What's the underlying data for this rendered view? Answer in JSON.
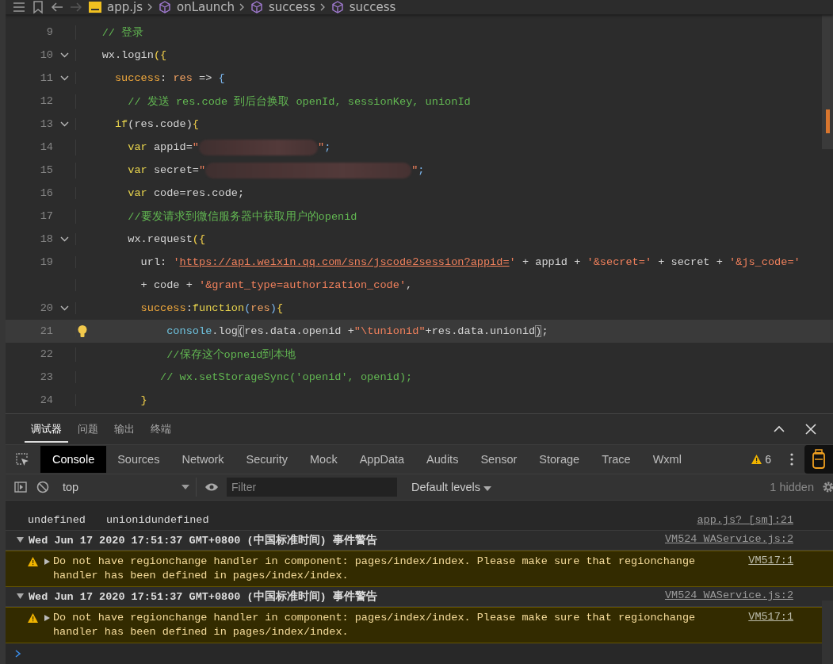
{
  "editor": {
    "breadcrumb": [
      {
        "kind": "file",
        "text": "app.js"
      },
      {
        "kind": "symbol",
        "text": "onLaunch"
      },
      {
        "kind": "symbol",
        "text": "success"
      },
      {
        "kind": "symbol",
        "text": "success"
      }
    ],
    "lines": [
      {
        "number": "9",
        "foldable": false,
        "tokens": [
          {
            "kind": "comment",
            "text": "    // 登录"
          }
        ]
      },
      {
        "number": "10",
        "foldable": true,
        "tokens": [
          {
            "kind": "plain",
            "text": "    wx.login"
          },
          {
            "kind": "brace",
            "text": "({"
          }
        ]
      },
      {
        "number": "11",
        "foldable": true,
        "tokens": [
          {
            "kind": "prop",
            "text": "      success"
          },
          {
            "kind": "plain",
            "text": ": "
          },
          {
            "kind": "param",
            "text": "res"
          },
          {
            "kind": "plain",
            "text": " => "
          },
          {
            "kind": "brace2",
            "text": "{"
          }
        ]
      },
      {
        "number": "12",
        "foldable": false,
        "tokens": [
          {
            "kind": "comment",
            "text": "        // 发送 res.code 到后台换取 openId, sessionKey, unionId"
          }
        ]
      },
      {
        "number": "13",
        "foldable": true,
        "tokens": [
          {
            "kind": "keyword",
            "text": "      if"
          },
          {
            "kind": "plain",
            "text": "(res.code)"
          },
          {
            "kind": "brace",
            "text": "{"
          }
        ]
      },
      {
        "number": "14",
        "foldable": false,
        "tokens": [
          {
            "kind": "keyword",
            "text": "        var"
          },
          {
            "kind": "plain",
            "text": " appid="
          },
          {
            "kind": "string",
            "text": "\""
          },
          {
            "kind": "redacted"
          },
          {
            "kind": "string",
            "text": "\""
          },
          {
            "kind": "punct",
            "text": ";"
          }
        ]
      },
      {
        "number": "15",
        "foldable": false,
        "tokens": [
          {
            "kind": "keyword",
            "text": "        var"
          },
          {
            "kind": "plain",
            "text": " secret="
          },
          {
            "kind": "string",
            "text": "\""
          },
          {
            "kind": "redacted_long"
          },
          {
            "kind": "string",
            "text": "\""
          },
          {
            "kind": "punct",
            "text": ";"
          }
        ]
      },
      {
        "number": "16",
        "foldable": false,
        "tokens": [
          {
            "kind": "keyword",
            "text": "        var"
          },
          {
            "kind": "plain",
            "text": " code=res.code;"
          }
        ]
      },
      {
        "number": "17",
        "foldable": false,
        "tokens": [
          {
            "kind": "comment",
            "text": "        //要发请求到微信服务器中获取用户的openid"
          }
        ]
      },
      {
        "number": "18",
        "foldable": true,
        "tokens": [
          {
            "kind": "plain",
            "text": "        wx.request"
          },
          {
            "kind": "brace",
            "text": "({"
          }
        ]
      },
      {
        "number": "19",
        "foldable": false,
        "tokens": [
          {
            "kind": "plain",
            "text": "          url: "
          },
          {
            "kind": "string",
            "text": "'"
          },
          {
            "kind": "url",
            "text": "https://api.weixin.qq.com/sns/jscode2session?appid="
          },
          {
            "kind": "string",
            "text": "'"
          },
          {
            "kind": "plain",
            "text": " + appid + "
          },
          {
            "kind": "string",
            "text": "'&secret='"
          },
          {
            "kind": "plain",
            "text": " + secret + "
          },
          {
            "kind": "string",
            "text": "'&js_code='"
          }
        ]
      },
      {
        "foldable": false,
        "tokens": [
          {
            "kind": "plain",
            "text": "          + code + "
          },
          {
            "kind": "string",
            "text": "'&grant_type=authorization_code'"
          },
          {
            "kind": "plain",
            "text": ","
          }
        ]
      },
      {
        "number": "20",
        "foldable": true,
        "tokens": [
          {
            "kind": "prop",
            "text": "          success"
          },
          {
            "kind": "plain",
            "text": ":"
          },
          {
            "kind": "keyword",
            "text": "function"
          },
          {
            "kind": "brace2",
            "text": "("
          },
          {
            "kind": "param",
            "text": "res"
          },
          {
            "kind": "brace2",
            "text": ")"
          },
          {
            "kind": "brace",
            "text": "{"
          }
        ]
      },
      {
        "number": "21",
        "foldable": false,
        "highlighted": true,
        "hint": true,
        "tokens": [
          {
            "kind": "object",
            "text": "              console"
          },
          {
            "kind": "plain",
            "text": ".log"
          },
          {
            "kind": "match",
            "text": "("
          },
          {
            "kind": "plain",
            "text": "res.data.openid +"
          },
          {
            "kind": "string",
            "text": "\"\\tunionid\""
          },
          {
            "kind": "plain",
            "text": "+res.data.unionid"
          },
          {
            "kind": "match",
            "text": ")"
          },
          {
            "kind": "plain",
            "text": ";"
          }
        ]
      },
      {
        "number": "22",
        "foldable": false,
        "tokens": [
          {
            "kind": "comment",
            "text": "              //保存这个opneid到本地"
          }
        ]
      },
      {
        "number": "23",
        "foldable": false,
        "tokens": [
          {
            "kind": "comment",
            "text": "             // wx.setStorageSync('openid', openid);"
          }
        ]
      },
      {
        "number": "24",
        "foldable": false,
        "tokens": [
          {
            "kind": "brace",
            "text": "          }"
          }
        ]
      }
    ]
  },
  "panel": {
    "tabs": [
      {
        "label": "调试器",
        "selected": true
      },
      {
        "label": "问题",
        "selected": false
      },
      {
        "label": "输出",
        "selected": false
      },
      {
        "label": "终端",
        "selected": false
      }
    ],
    "tool_tabs": [
      {
        "label": "Console",
        "selected": true
      },
      {
        "label": "Sources",
        "selected": false
      },
      {
        "label": "Network",
        "selected": false
      },
      {
        "label": "Security",
        "selected": false
      },
      {
        "label": "Mock",
        "selected": false
      },
      {
        "label": "AppData",
        "selected": false
      },
      {
        "label": "Audits",
        "selected": false
      },
      {
        "label": "Sensor",
        "selected": false
      },
      {
        "label": "Storage",
        "selected": false
      },
      {
        "label": "Trace",
        "selected": false
      },
      {
        "label": "Wxml",
        "selected": false
      }
    ],
    "warning_count": "6",
    "toolbar": {
      "context": "top",
      "filter_placeholder": "Filter",
      "levels": "Default levels",
      "hidden": "1 hidden"
    },
    "messages": [
      {
        "kind": "log",
        "parts": [
          "undefined",
          "unionidundefined"
        ],
        "source": "app.js? [sm]:21"
      },
      {
        "kind": "group",
        "text": "Wed Jun 17 2020 17:51:37 GMT+0800 (中国标准时间) 事件警告",
        "source": "VM524 WAService.js:2"
      },
      {
        "kind": "warning",
        "text": "Do not have regionchange handler in component: pages/index/index. Please make sure that regionchange handler has been defined in pages/index/index.",
        "source": "VM517:1"
      },
      {
        "kind": "group",
        "text": "Wed Jun 17 2020 17:51:37 GMT+0800 (中国标准时间) 事件警告",
        "source": "VM524 WAService.js:2"
      },
      {
        "kind": "warning",
        "text": "Do not have regionchange handler in component: pages/index/index. Please make sure that regionchange handler has been defined in pages/index/index.",
        "source": "VM517:1"
      }
    ]
  }
}
